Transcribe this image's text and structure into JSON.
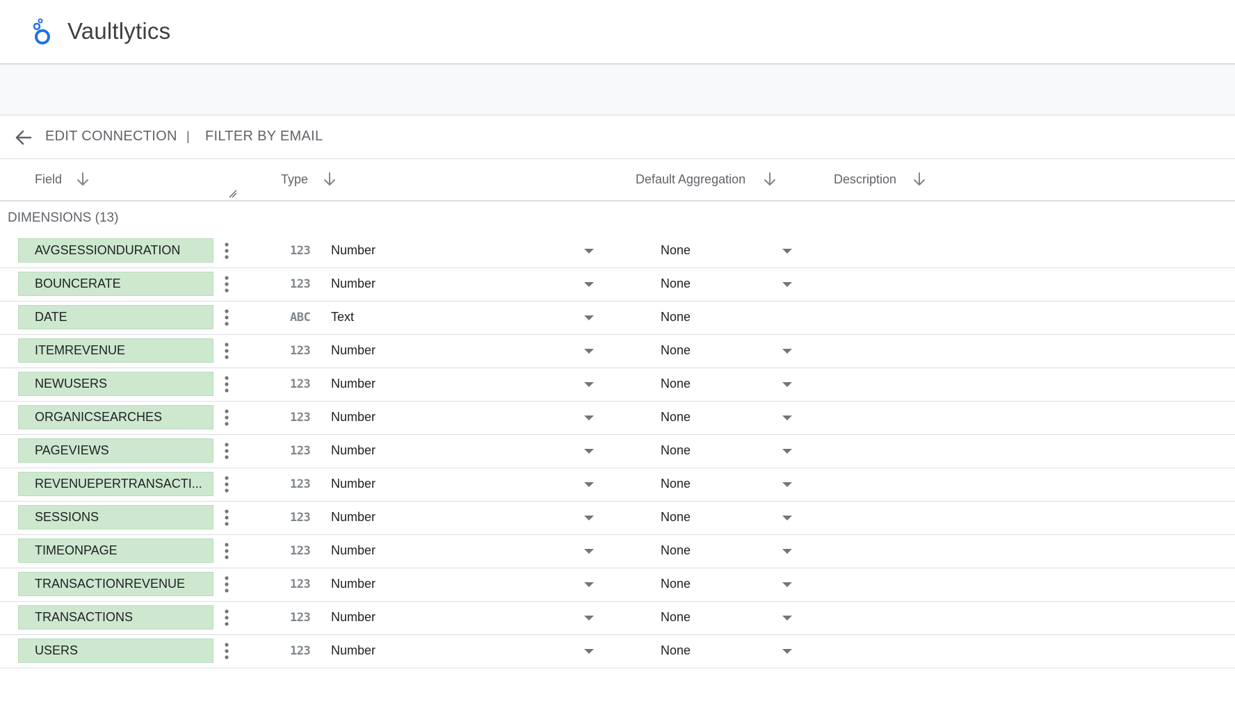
{
  "app": {
    "title": "Vaultlytics",
    "brand_color": "#1a73e8"
  },
  "nav": {
    "back_icon": "arrow-back-icon",
    "edit_connection": "EDIT CONNECTION",
    "separator": "|",
    "filter_by_email": "FILTER BY EMAIL"
  },
  "columns": {
    "field": "Field",
    "type": "Type",
    "default_aggregation": "Default Aggregation",
    "description": "Description",
    "sort_icon": "arrow-down-icon"
  },
  "section": {
    "label": "DIMENSIONS (13)"
  },
  "colors": {
    "chip_background": "#cde8cf",
    "divider": "#dadce0",
    "muted_text": "#5f6368"
  },
  "rows": [
    {
      "field": "AVGSESSIONDURATION",
      "type_glyph": "123",
      "type": "Number",
      "aggregation": "None",
      "aggregation_dropdown": true
    },
    {
      "field": "BOUNCERATE",
      "type_glyph": "123",
      "type": "Number",
      "aggregation": "None",
      "aggregation_dropdown": true
    },
    {
      "field": "DATE",
      "type_glyph": "ABC",
      "type": "Text",
      "aggregation": "None",
      "aggregation_dropdown": false
    },
    {
      "field": "ITEMREVENUE",
      "type_glyph": "123",
      "type": "Number",
      "aggregation": "None",
      "aggregation_dropdown": true
    },
    {
      "field": "NEWUSERS",
      "type_glyph": "123",
      "type": "Number",
      "aggregation": "None",
      "aggregation_dropdown": true
    },
    {
      "field": "ORGANICSEARCHES",
      "type_glyph": "123",
      "type": "Number",
      "aggregation": "None",
      "aggregation_dropdown": true
    },
    {
      "field": "PAGEVIEWS",
      "type_glyph": "123",
      "type": "Number",
      "aggregation": "None",
      "aggregation_dropdown": true
    },
    {
      "field": "REVENUEPERTRANSACTI...",
      "type_glyph": "123",
      "type": "Number",
      "aggregation": "None",
      "aggregation_dropdown": true
    },
    {
      "field": "SESSIONS",
      "type_glyph": "123",
      "type": "Number",
      "aggregation": "None",
      "aggregation_dropdown": true
    },
    {
      "field": "TIMEONPAGE",
      "type_glyph": "123",
      "type": "Number",
      "aggregation": "None",
      "aggregation_dropdown": true
    },
    {
      "field": "TRANSACTIONREVENUE",
      "type_glyph": "123",
      "type": "Number",
      "aggregation": "None",
      "aggregation_dropdown": true
    },
    {
      "field": "TRANSACTIONS",
      "type_glyph": "123",
      "type": "Number",
      "aggregation": "None",
      "aggregation_dropdown": true
    },
    {
      "field": "USERS",
      "type_glyph": "123",
      "type": "Number",
      "aggregation": "None",
      "aggregation_dropdown": true
    }
  ]
}
